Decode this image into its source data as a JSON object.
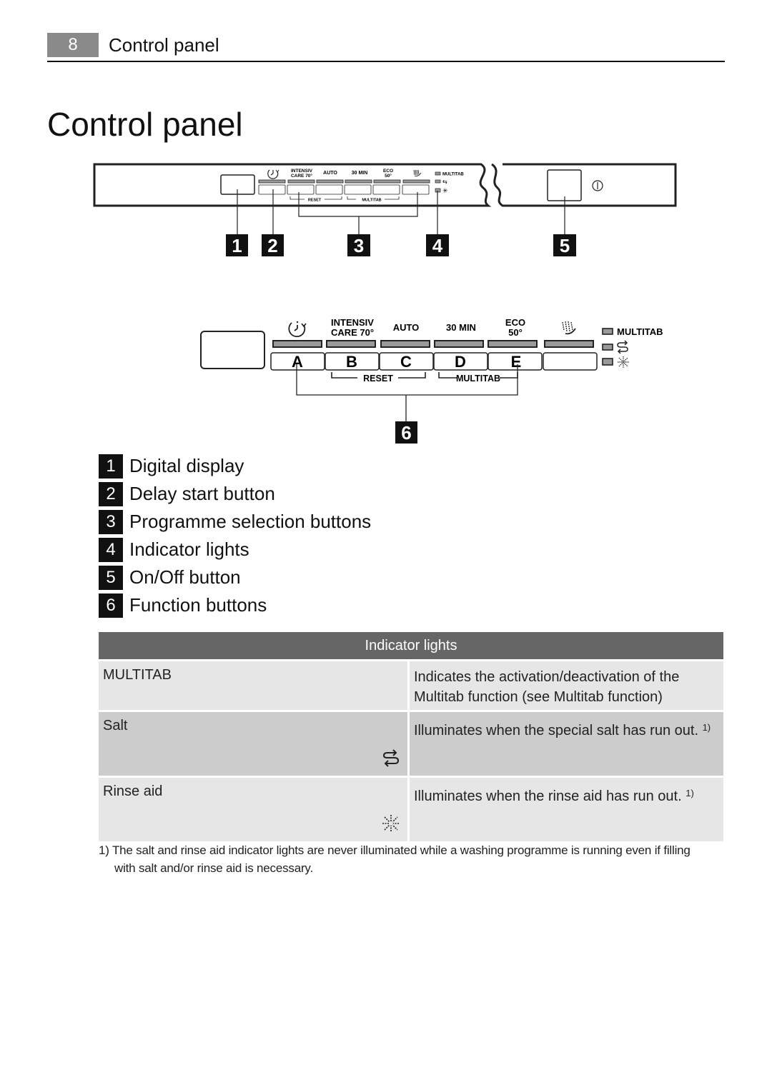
{
  "header": {
    "page_number": "8",
    "section_title": "Control panel"
  },
  "page_title": "Control panel",
  "overview_diagram": {
    "button_labels": [
      "INTENSIV\nCARE 70°",
      "AUTO",
      "30 MIN",
      "ECO\n50°"
    ],
    "label_intensiv_1": "INTENSIV",
    "label_intensiv_2": "CARE 70°",
    "label_auto": "AUTO",
    "label_30min": "30 MIN",
    "label_eco_1": "ECO",
    "label_eco_2": "50°",
    "label_multitab": "MULTITAB",
    "bracket_reset": "RESET",
    "bracket_multitab": "MULTITAB",
    "callouts": [
      "1",
      "2",
      "3",
      "4",
      "5"
    ],
    "icons": [
      "delay-start-icon",
      "rinse-hand-icon",
      "salt-icon",
      "rinse-aid-icon",
      "power-icon"
    ]
  },
  "detail_diagram": {
    "label_intensiv_1": "INTENSIV",
    "label_intensiv_2": "CARE 70°",
    "label_auto": "AUTO",
    "label_30min": "30 MIN",
    "label_eco_1": "ECO",
    "label_eco_2": "50°",
    "label_multitab": "MULTITAB",
    "buttons": [
      "A",
      "B",
      "C",
      "D",
      "E",
      ""
    ],
    "bracket_reset": "RESET",
    "bracket_multitab": "MULTITAB",
    "callout": "6"
  },
  "legend": [
    {
      "num": "1",
      "label": "Digital display"
    },
    {
      "num": "2",
      "label": "Delay start button"
    },
    {
      "num": "3",
      "label": "Programme selection buttons"
    },
    {
      "num": "4",
      "label": "Indicator lights"
    },
    {
      "num": "5",
      "label": "On/Off button"
    },
    {
      "num": "6",
      "label": "Function buttons"
    }
  ],
  "indicator_table": {
    "title": "Indicator lights",
    "rows": [
      {
        "name": "MULTITAB",
        "icon": "",
        "description": "Indicates the activation/deactivation of the Multitab function (see Multitab function)",
        "footnote": ""
      },
      {
        "name": "Salt",
        "icon": "salt-icon",
        "description": "Illuminates when the special salt has run out.",
        "footnote": "1)"
      },
      {
        "name": "Rinse aid",
        "icon": "rinse-aid-icon",
        "description": "Illuminates when the rinse aid has run out.",
        "footnote": "1)"
      }
    ]
  },
  "footnote": {
    "marker": "1)",
    "line1": "The salt and rinse aid indicator lights are never illuminated while a washing programme is running even if filling",
    "line2": "with salt and/or rinse aid is necessary."
  }
}
